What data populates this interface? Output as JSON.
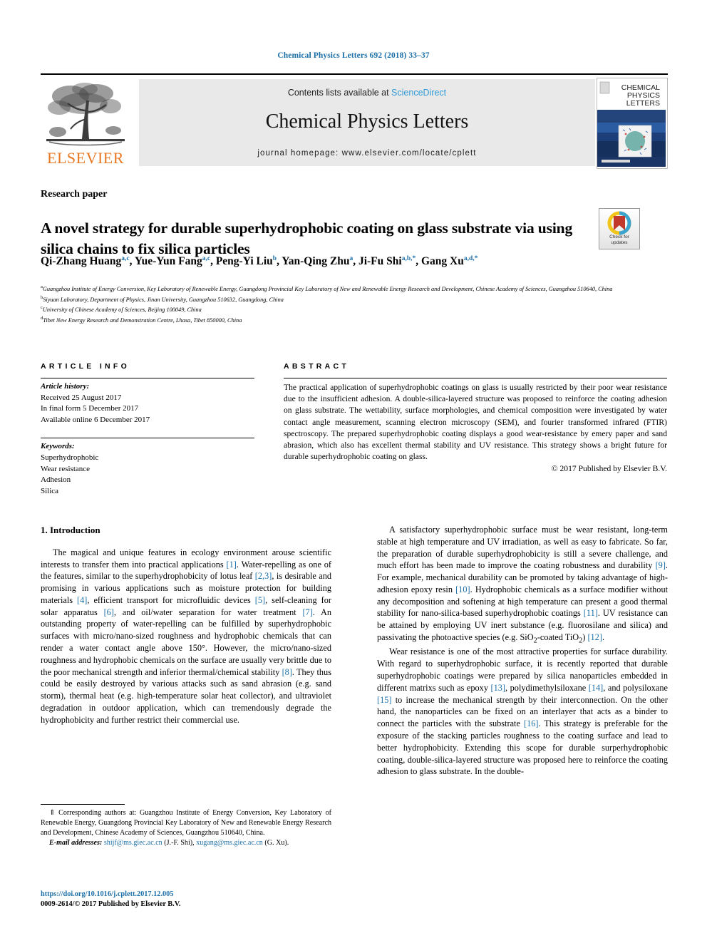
{
  "running_head": "Chemical Physics Letters 692 (2018) 33–37",
  "masthead": {
    "publisher": "ELSEVIER",
    "contents_prefix": "Contents lists available at ",
    "contents_link": "ScienceDirect",
    "journal_title": "Chemical Physics Letters",
    "homepage": "journal homepage: www.elsevier.com/locate/cplett",
    "cover_line1": "CHEMICAL",
    "cover_line2": "PHYSICS",
    "cover_line3": "LETTERS"
  },
  "crossmark": {
    "line1": "Check for",
    "line2": "updates"
  },
  "article_category": "Research paper",
  "title": "A novel strategy for durable superhydrophobic coating on glass substrate via using silica chains to fix silica particles",
  "authors": [
    {
      "name": "Qi-Zhang Huang",
      "sup": "a,c",
      "sep": ", "
    },
    {
      "name": "Yue-Yun Fang",
      "sup": "a,c",
      "sep": ", "
    },
    {
      "name": "Peng-Yi Liu",
      "sup": "b",
      "sep": ", "
    },
    {
      "name": "Yan-Qing Zhu",
      "sup": "a",
      "sep": ", "
    },
    {
      "name": "Ji-Fu Shi",
      "sup": "a,b,*",
      "sep": ", "
    },
    {
      "name": "Gang Xu",
      "sup": "a,d,*",
      "sep": ""
    }
  ],
  "affiliations": [
    {
      "marker": "a",
      "text": "Guangzhou Institute of Energy Conversion, Key Laboratory of Renewable Energy, Guangdong Provincial Key Laboratory of New and Renewable Energy Research and Development, Chinese Academy of Sciences, Guangzhou 510640, China"
    },
    {
      "marker": "b",
      "text": "Siyuan Laboratory, Department of Physics, Jinan University, Guangzhou 510632, Guangdong, China"
    },
    {
      "marker": "c",
      "text": "University of Chinese Academy of Sciences, Beijing 100049, China"
    },
    {
      "marker": "d",
      "text": "Tibet New Energy Research and Demonstration Centre, Lhasa, Tibet 850000, China"
    }
  ],
  "article_info": {
    "heading": "ARTICLE INFO",
    "history_label": "Article history:",
    "history": [
      "Received 25 August 2017",
      "In final form 5 December 2017",
      "Available online 6 December 2017"
    ],
    "keywords_label": "Keywords:",
    "keywords": [
      "Superhydrophobic",
      "Wear resistance",
      "Adhesion",
      "Silica"
    ]
  },
  "abstract": {
    "heading": "ABSTRACT",
    "text": "The practical application of superhydrophobic coatings on glass is usually restricted by their poor wear resistance due to the insufficient adhesion. A double-silica-layered structure was proposed to reinforce the coating adhesion on glass substrate. The wettability, surface morphologies, and chemical composition were investigated by water contact angle measurement, scanning electron microscopy (SEM), and fourier transformed infrared (FTIR) spectroscopy. The prepared superhydrophobic coating displays a good wear-resistance by emery paper and sand abrasion, which also has excellent thermal stability and UV resistance. This strategy shows a bright future for durable superhydrophobic coating on glass.",
    "copyright": "© 2017 Published by Elsevier B.V."
  },
  "body": {
    "section1_heading": "1. Introduction",
    "left_paragraphs": [
      "The magical and unique features in ecology environment arouse scientific interests to transfer them into practical applications [1]. Water-repelling as one of the features, similar to the superhydrophobicity of lotus leaf [2,3], is desirable and promising in various applications such as moisture protection for building materials [4], efficient transport for microfluidic devices [5], self-cleaning for solar apparatus [6], and oil/water separation for water treatment [7]. An outstanding property of water-repelling can be fulfilled by superhydrophobic surfaces with micro/nano-sized roughness and hydrophobic chemicals that can render a water contact angle above 150°. However, the micro/nano-sized roughness and hydrophobic chemicals on the surface are usually very brittle due to the poor mechanical strength and inferior thermal/chemical stability [8]. They thus could be easily destroyed by various attacks such as sand abrasion (e.g. sand storm), thermal heat (e.g. high-temperature solar heat collector), and ultraviolet degradation in outdoor application, which can tremendously degrade the hydrophobicity and further restrict their commercial use."
    ],
    "right_paragraphs": [
      "A satisfactory superhydrophobic surface must be wear resistant, long-term stable at high temperature and UV irradiation, as well as easy to fabricate. So far, the preparation of durable superhydrophobicity is still a severe challenge, and much effort has been made to improve the coating robustness and durability [9]. For example, mechanical durability can be promoted by taking advantage of high-adhesion epoxy resin [10]. Hydrophobic chemicals as a surface modifier without any decomposition and softening at high temperature can present a good thermal stability for nano-silica-based superhydrophobic coatings [11]. UV resistance can be attained by employing UV inert substance (e.g. fluorosilane and silica) and passivating the photoactive species (e.g. SiO2-coated TiO2) [12].",
      "Wear resistance is one of the most attractive properties for surface durability. With regard to superhydrophobic surface, it is recently reported that durable superhydrophobic coatings were prepared by silica nanoparticles embedded in different matrixs such as epoxy [13], polydimethylsiloxane [14], and polysiloxane [15] to increase the mechanical strength by their interconnection. On the other hand, the nanoparticles can be fixed on an interlayer that acts as a binder to connect the particles with the substrate [16]. This strategy is preferable for the exposure of the stacking particles roughness to the coating surface and lead to better hydrophobicity. Extending this scope for durable surperhydrophobic coating, double-silica-layered structure was proposed here to reinforce the coating adhesion to glass substrate. In the double-"
    ]
  },
  "footnote": {
    "corresponding": "⇑ Corresponding authors at: Guangzhou Institute of Energy Conversion, Key Laboratory of Renewable Energy, Guangdong Provincial Key Laboratory of New and Renewable Energy Research and Development, Chinese Academy of Sciences, Guangzhou 510640, China.",
    "email_label": "E-mail addresses:",
    "email1": "shijf@ms.giec.ac.cn",
    "email1_owner": "(J.-F. Shi),",
    "email2": "xugang@ms.giec.ac.cn",
    "email2_owner": "(G. Xu)."
  },
  "doi_block": {
    "doi": "https://doi.org/10.1016/j.cplett.2017.12.005",
    "issn_line": "0009-2614/© 2017 Published by Elsevier B.V."
  },
  "colors": {
    "link_blue": "#1b6fa8",
    "sd_blue": "#2e9bd6",
    "elsevier_orange": "#e87722"
  }
}
